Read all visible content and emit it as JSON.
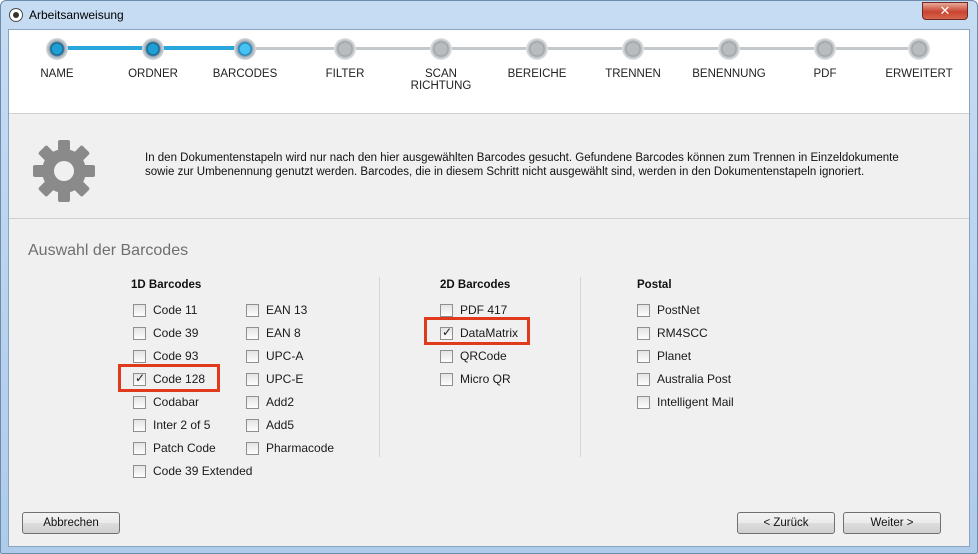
{
  "window": {
    "title": "Arbeitsanweisung",
    "close_label": "✕"
  },
  "steps": [
    {
      "label": "NAME",
      "state": "done"
    },
    {
      "label": "ORDNER",
      "state": "done"
    },
    {
      "label": "BARCODES",
      "state": "active"
    },
    {
      "label": "FILTER",
      "state": "todo"
    },
    {
      "label": "SCAN RICHTUNG",
      "state": "todo"
    },
    {
      "label": "BEREICHE",
      "state": "todo"
    },
    {
      "label": "TRENNEN",
      "state": "todo"
    },
    {
      "label": "BENENNUNG",
      "state": "todo"
    },
    {
      "label": "PDF",
      "state": "todo"
    },
    {
      "label": "ERWEITERT",
      "state": "todo"
    }
  ],
  "info": {
    "icon": "gear-icon",
    "text": "In den Dokumentenstapeln wird nur nach den hier ausgewählten Barcodes gesucht. Gefundene Barcodes können zum Trennen in Einzeldokumente sowie zur Umbenennung genutzt werden. Barcodes, die in diesem Schritt nicht ausgewählt sind, werden in den Dokumentenstapeln ignoriert."
  },
  "section_title": "Auswahl der Barcodes",
  "groups": {
    "one_d": {
      "title": "1D Barcodes",
      "col1": [
        {
          "label": "Code 11",
          "checked": false
        },
        {
          "label": "Code 39",
          "checked": false
        },
        {
          "label": "Code 93",
          "checked": false
        },
        {
          "label": "Code 128",
          "checked": true
        },
        {
          "label": "Codabar",
          "checked": false
        },
        {
          "label": "Inter 2 of 5",
          "checked": false
        },
        {
          "label": "Patch Code",
          "checked": false
        },
        {
          "label": "Code 39 Extended",
          "checked": false
        }
      ],
      "col2": [
        {
          "label": "EAN 13",
          "checked": false
        },
        {
          "label": "EAN 8",
          "checked": false
        },
        {
          "label": "UPC-A",
          "checked": false
        },
        {
          "label": "UPC-E",
          "checked": false
        },
        {
          "label": "Add2",
          "checked": false
        },
        {
          "label": "Add5",
          "checked": false
        },
        {
          "label": "Pharmacode",
          "checked": false
        }
      ]
    },
    "two_d": {
      "title": "2D Barcodes",
      "items": [
        {
          "label": "PDF 417",
          "checked": false
        },
        {
          "label": "DataMatrix",
          "checked": true
        },
        {
          "label": "QRCode",
          "checked": false
        },
        {
          "label": "Micro QR",
          "checked": false
        }
      ]
    },
    "postal": {
      "title": "Postal",
      "items": [
        {
          "label": "PostNet",
          "checked": false
        },
        {
          "label": "RM4SCC",
          "checked": false
        },
        {
          "label": "Planet",
          "checked": false
        },
        {
          "label": "Australia Post",
          "checked": false
        },
        {
          "label": "Intelligent Mail",
          "checked": false
        }
      ]
    }
  },
  "buttons": {
    "cancel": "Abbrechen",
    "back": "< Zurück",
    "next": "Weiter >"
  },
  "colors": {
    "highlight": "#e0391b",
    "progress": "#2aa6dc"
  }
}
